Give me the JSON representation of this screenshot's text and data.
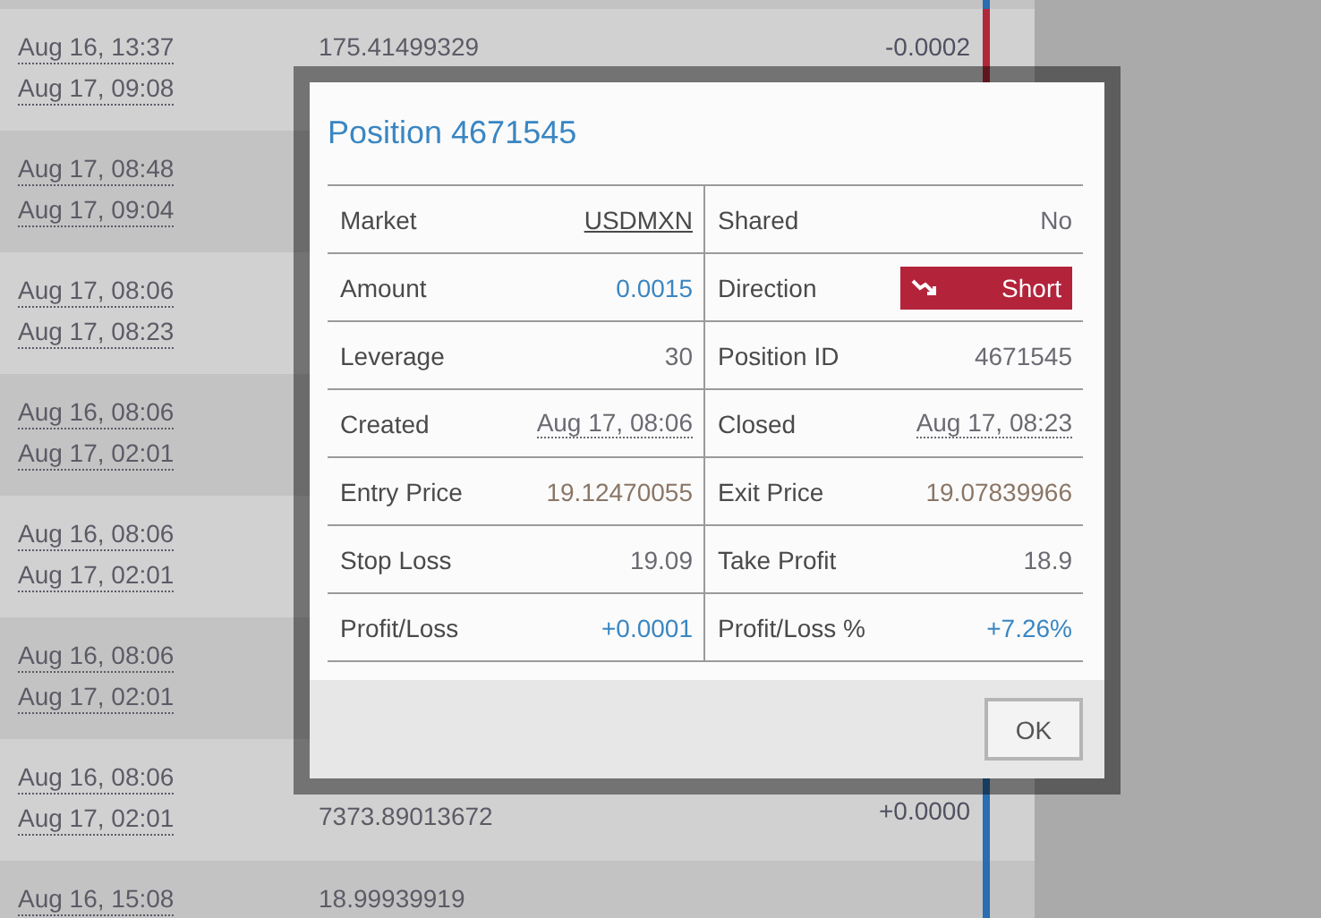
{
  "rows": [
    {
      "dates": [],
      "prices": [],
      "color": "#2a6db0"
    },
    {
      "dates": [
        "Aug 16, 13:37",
        "Aug 17, 09:08"
      ],
      "prices": [
        "175.41499329"
      ],
      "change": "-0.0002",
      "color": "#b0283a"
    },
    {
      "dates": [
        "Aug 17, 08:48",
        "Aug 17, 09:04"
      ],
      "prices": []
    },
    {
      "dates": [
        "Aug 17, 08:06",
        "Aug 17, 08:23"
      ],
      "prices": []
    },
    {
      "dates": [
        "Aug 16, 08:06",
        "Aug 17, 02:01"
      ],
      "prices": []
    },
    {
      "dates": [
        "Aug 16, 08:06",
        "Aug 17, 02:01"
      ],
      "prices": []
    },
    {
      "dates": [
        "Aug 16, 08:06",
        "Aug 17, 02:01"
      ],
      "prices": []
    },
    {
      "dates": [
        "Aug 16, 08:06",
        "Aug 17, 02:01"
      ],
      "prices": [],
      "price_lower": "7373.89013672",
      "change": "+0.0000",
      "color": "#2a6db0"
    },
    {
      "dates": [
        "Aug 16, 15:08"
      ],
      "prices": [
        "18.99939919"
      ],
      "color": "#2a6db0"
    }
  ],
  "dialog": {
    "title": "Position 4671545",
    "fields": [
      {
        "label": "Market",
        "value": "USDMXN",
        "kind": "link"
      },
      {
        "label": "Shared",
        "value": "No",
        "kind": "plain"
      },
      {
        "label": "Amount",
        "value": "0.0015",
        "kind": "accent"
      },
      {
        "label": "Direction",
        "value": "Short",
        "kind": "badge"
      },
      {
        "label": "Leverage",
        "value": "30",
        "kind": "plain"
      },
      {
        "label": "Position ID",
        "value": "4671545",
        "kind": "plain"
      },
      {
        "label": "Created",
        "value": "Aug 17, 08:06",
        "kind": "date"
      },
      {
        "label": "Closed",
        "value": "Aug 17, 08:23",
        "kind": "date"
      },
      {
        "label": "Entry Price",
        "value": "19.12470055",
        "kind": "price"
      },
      {
        "label": "Exit Price",
        "value": "19.07839966",
        "kind": "price"
      },
      {
        "label": "Stop Loss",
        "value": "19.09",
        "kind": "plain"
      },
      {
        "label": "Take Profit",
        "value": "18.9",
        "kind": "plain"
      },
      {
        "label": "Profit/Loss",
        "value": "+0.0001",
        "kind": "accent"
      },
      {
        "label": "Profit/Loss %",
        "value": "+7.26%",
        "kind": "accent"
      }
    ],
    "button": "OK"
  }
}
